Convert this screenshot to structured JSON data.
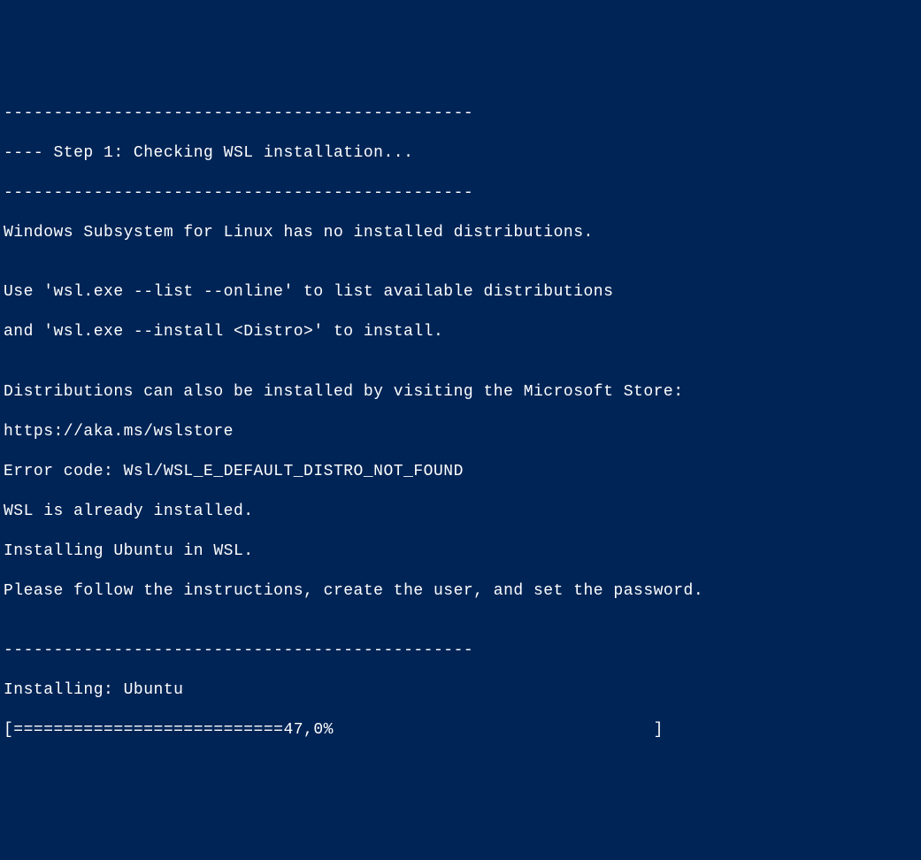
{
  "terminal": {
    "lines": [
      "-----------------------------------------------",
      "---- Step 1: Checking WSL installation...",
      "-----------------------------------------------",
      "Windows Subsystem for Linux has no installed distributions.",
      "",
      "Use 'wsl.exe --list --online' to list available distributions",
      "and 'wsl.exe --install <Distro>' to install.",
      "",
      "Distributions can also be installed by visiting the Microsoft Store:",
      "https://aka.ms/wslstore",
      "Error code: Wsl/WSL_E_DEFAULT_DISTRO_NOT_FOUND",
      "WSL is already installed.",
      "Installing Ubuntu in WSL.",
      "Please follow the instructions, create the user, and set the password.",
      "",
      "-----------------------------------------------",
      "Installing: Ubuntu"
    ],
    "progress_line": "[===========================47,0%                                ]"
  }
}
